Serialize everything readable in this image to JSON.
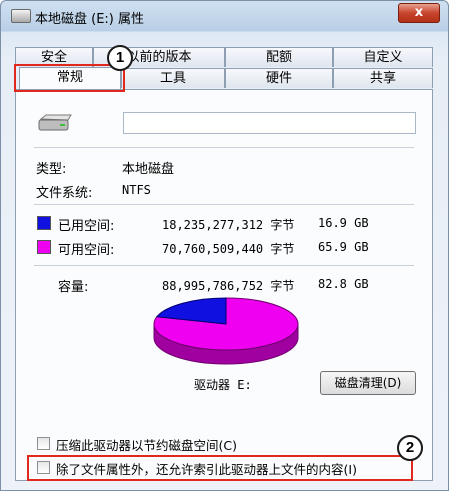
{
  "window": {
    "title": "本地磁盘 (E:) 属性",
    "close_glyph": "x"
  },
  "tabs_back": [
    "安全",
    "以前的版本",
    "配额",
    "自定义"
  ],
  "tabs_front": [
    "常规",
    "工具",
    "硬件",
    "共享"
  ],
  "general": {
    "name_value": "",
    "type_label": "类型:",
    "type_value": "本地磁盘",
    "fs_label": "文件系统:",
    "fs_value": "NTFS",
    "used": {
      "label": "已用空间:",
      "bytes": "18,235,277,312 字节",
      "size": "16.9 GB",
      "color": "#1010e0"
    },
    "free": {
      "label": "可用空间:",
      "bytes": "70,760,509,440 字节",
      "size": "65.9 GB",
      "color": "#f000f0"
    },
    "capacity": {
      "label": "容量:",
      "bytes": "88,995,786,752 字节",
      "size": "82.8 GB"
    },
    "pie": {
      "used_fraction": 0.205,
      "free_fraction": 0.795
    },
    "drive_label": "驱动器 E:",
    "cleanup_button": "磁盘清理(D)",
    "compress_label": "压缩此驱动器以节约磁盘空间(C)",
    "index_label": "除了文件属性外，还允许索引此驱动器上文件的内容(I)"
  },
  "annotations": {
    "badge1": "1",
    "badge2": "2",
    "highlight_color": "#e0281f"
  }
}
